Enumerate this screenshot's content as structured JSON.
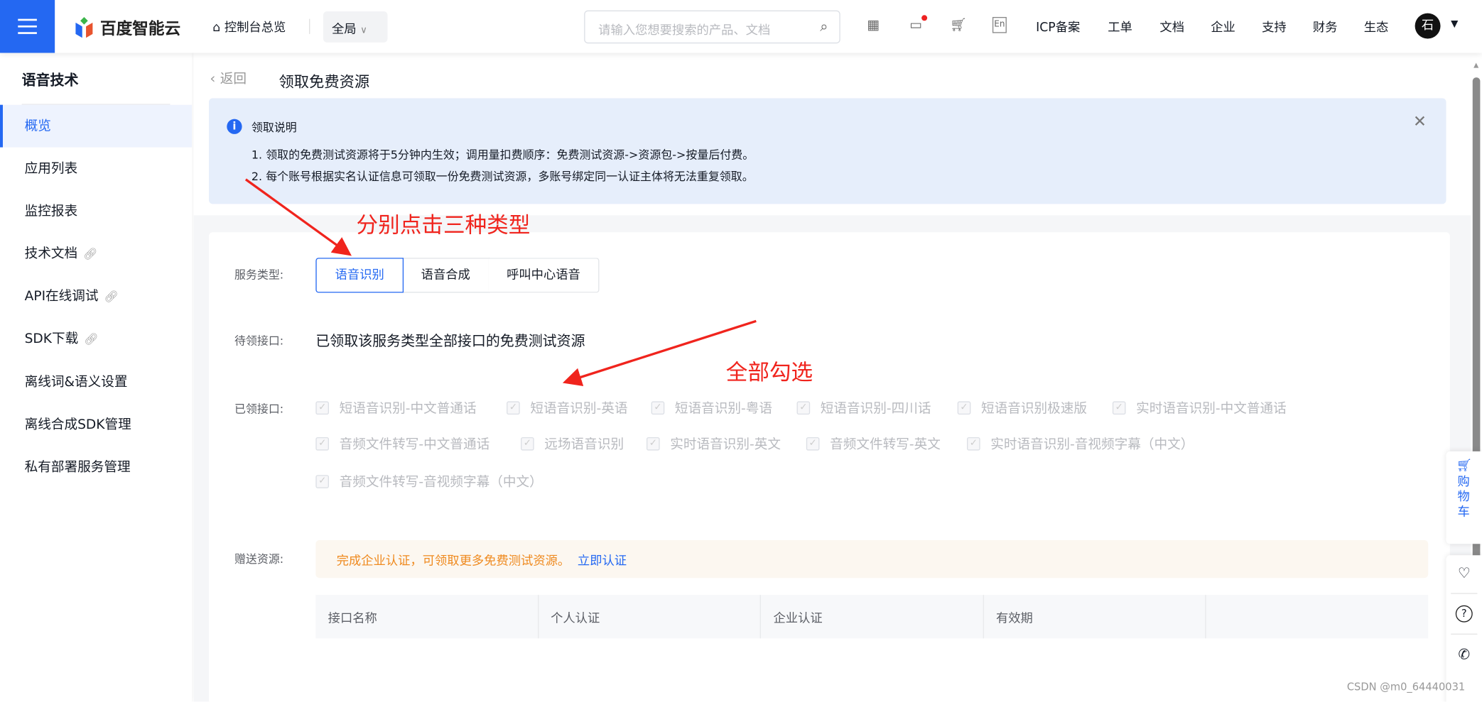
{
  "topbar": {
    "brand": "百度智能云",
    "console": "控制台总览",
    "scope": "全局",
    "search_placeholder": "请输入您想要搜索的产品、文档",
    "icons": [
      "qrcode-icon",
      "message-icon",
      "cart-icon",
      "language-icon"
    ],
    "lang": "En",
    "links": [
      "ICP备案",
      "工单",
      "文档",
      "企业",
      "支持",
      "财务",
      "生态"
    ],
    "avatar": "石"
  },
  "sidebar": {
    "title": "语音技术",
    "items": [
      {
        "label": "概览",
        "active": true
      },
      {
        "label": "应用列表"
      },
      {
        "label": "监控报表"
      },
      {
        "label": "技术文档",
        "external": true
      },
      {
        "label": "API在线调试",
        "external": true
      },
      {
        "label": "SDK下载",
        "external": true
      },
      {
        "label": "离线词&语义设置"
      },
      {
        "label": "离线合成SDK管理"
      },
      {
        "label": "私有部署服务管理"
      }
    ]
  },
  "page": {
    "back": "返回",
    "title": "领取免费资源"
  },
  "notice": {
    "title": "领取说明",
    "lines": [
      "1. 领取的免费测试资源将于5分钟内生效；调用量扣费顺序：免费测试资源->资源包->按量后付费。",
      "2. 每个账号根据实名认证信息可领取一份免费测试资源，多账号绑定同一认证主体将无法重复领取。"
    ]
  },
  "form": {
    "service_type_label": "服务类型:",
    "service_types": [
      "语音识别",
      "语音合成",
      "呼叫中心语音"
    ],
    "selected_service": "语音识别",
    "pending_label": "待领接口:",
    "pending_value": "已领取该服务类型全部接口的免费测试资源",
    "claimed_label": "已领接口:",
    "claimed": [
      "短语音识别-中文普通话",
      "短语音识别-英语",
      "短语音识别-粤语",
      "短语音识别-四川话",
      "短语音识别极速版",
      "实时语音识别-中文普通话",
      "音频文件转写-中文普通话",
      "远场语音识别",
      "实时语音识别-英文",
      "音频文件转写-英文",
      "实时语音识别-音视频字幕（中文）",
      "音频文件转写-音视频字幕（中文）"
    ],
    "gift_label": "赠送资源:",
    "gift_text": "完成企业认证，可领取更多免费测试资源。",
    "gift_link": "立即认证",
    "table_headers": [
      "接口名称",
      "个人认证",
      "企业认证",
      "有效期",
      ""
    ]
  },
  "annotations": {
    "a1": "分别点击三种类型",
    "a2": "全部勾选"
  },
  "float": {
    "cart": "购物车"
  },
  "watermark": "CSDN @m0_64440031",
  "colors": {
    "primary": "#2468f2",
    "annotation": "#f0241d",
    "warning": "#ef8a1f"
  }
}
